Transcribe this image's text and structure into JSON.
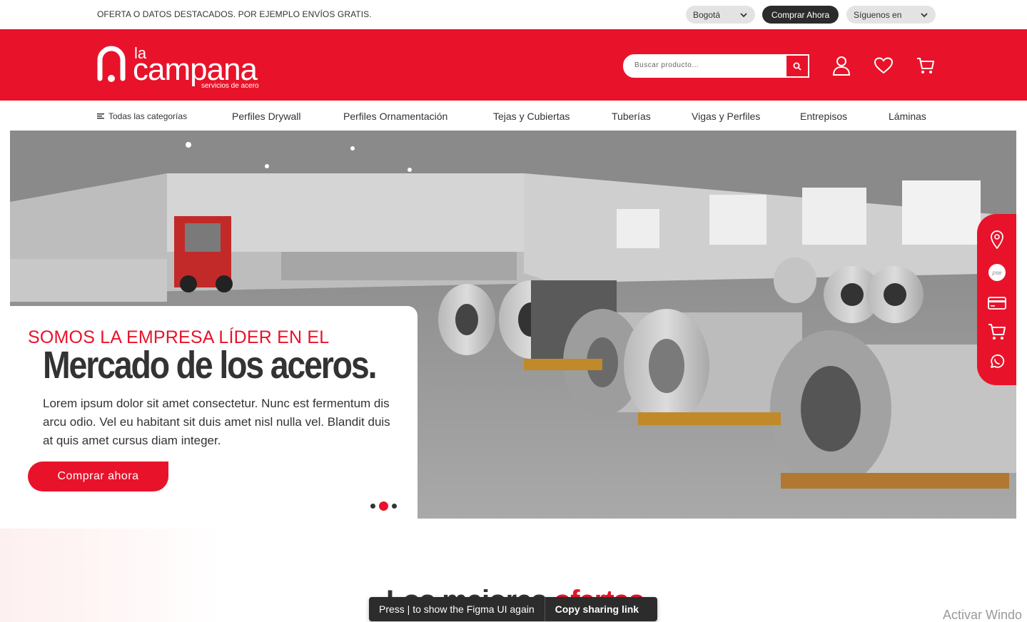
{
  "topbar": {
    "promo": "OFERTA O DATOS DESTACADOS. POR EJEMPLO ENVÍOS GRATIS.",
    "city": "Bogotá",
    "buy_now": "Comprar Ahora",
    "follow": "Síguenos en"
  },
  "header": {
    "logo_small": "la",
    "logo_main": "campana",
    "logo_tagline": "servicios de acero",
    "search_placeholder": "Buscar producto...",
    "icons": [
      "user-icon",
      "heart-icon",
      "cart-icon"
    ]
  },
  "nav": {
    "all_categories": "Todas las categorías",
    "items": [
      "Perfiles Drywall",
      "Perfiles Ornamentación",
      "Tejas y Cubiertas",
      "Tuberías",
      "Vigas y Perfiles",
      "Entrepisos",
      "Láminas"
    ]
  },
  "hero": {
    "subtitle": "SOMOS LA  EMPRESA LÍDER EN EL",
    "title": "Mercado de los aceros.",
    "body": "Lorem ipsum dolor sit amet consectetur. Nunc est fermentum dis arcu odio. Vel eu habitant sit duis amet nisl nulla vel. Blandit duis at quis amet cursus diam integer.",
    "cta": "Comprar ahora",
    "slides": 3,
    "active_slide": 2
  },
  "floating_bar": {
    "icons": [
      "location-icon",
      "pse-icon",
      "card-icon",
      "cart-icon",
      "whatsapp-icon"
    ],
    "pse_label": "pse"
  },
  "section": {
    "title_start": "Los mejores ",
    "title_accent": "ofertas"
  },
  "figma_toast": {
    "message": "Press | to show the Figma UI again",
    "action": "Copy sharing link"
  },
  "watermark": "Activar Windo",
  "colors": {
    "brand_red": "#e8132a",
    "dark": "#333333",
    "pill_gray": "#e3e3e3"
  }
}
